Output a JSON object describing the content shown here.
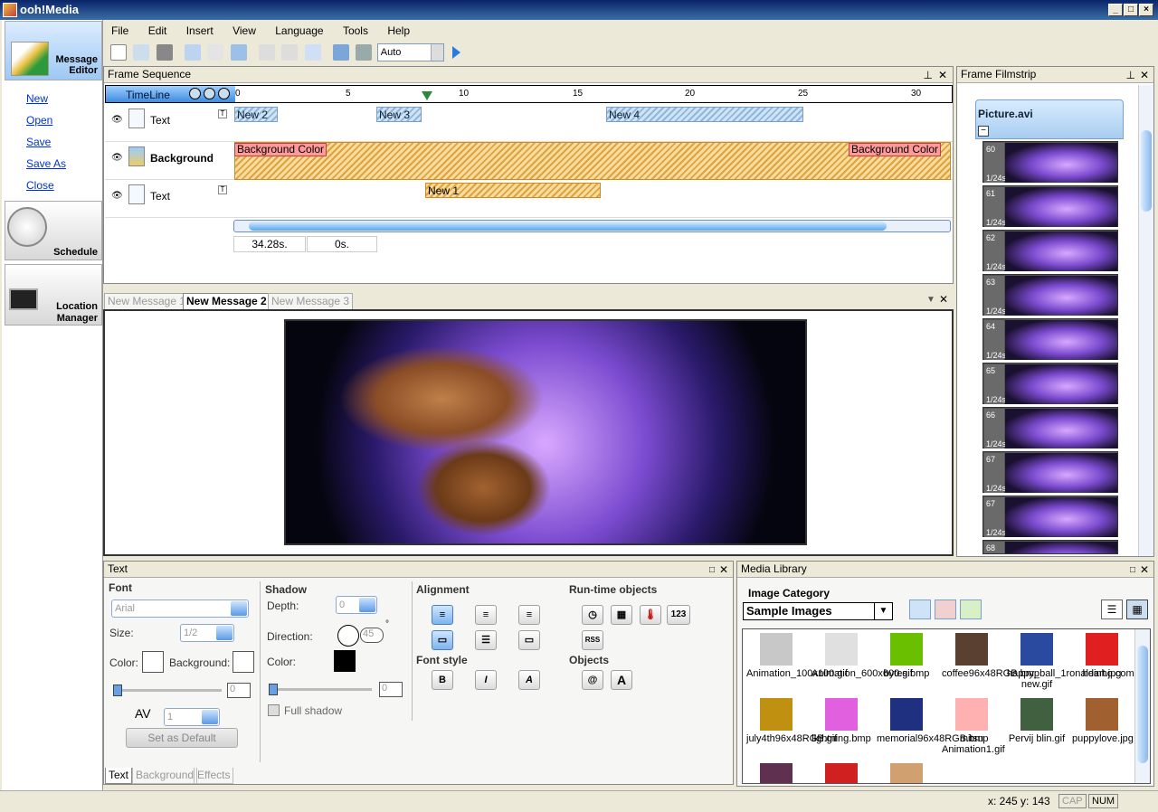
{
  "window": {
    "title": "ooh!Media",
    "min": "_",
    "max": "□",
    "close": "×"
  },
  "menu": [
    "File",
    "Edit",
    "Insert",
    "View",
    "Language",
    "Tools",
    "Help"
  ],
  "toolbar": {
    "zoom_value": "Auto"
  },
  "left_nav": {
    "message_editor": "Message Editor",
    "links": [
      "New",
      "Open",
      "Save",
      "Save As",
      "Close"
    ],
    "schedule": "Schedule",
    "location_manager": "Location Manager"
  },
  "frame_sequence": {
    "title": "Frame Sequence",
    "timeline_label": "TimeLine",
    "ruler_ticks": [
      "0",
      "5",
      "10",
      "15",
      "20",
      "25",
      "30"
    ],
    "tracks": [
      {
        "name": "Text",
        "blocks": [
          "New 2",
          "New 3",
          "New 4"
        ]
      },
      {
        "name": "Background",
        "blocks": [
          "Background Color",
          "Background Color"
        ]
      },
      {
        "name": "Text",
        "blocks": [
          "New 1"
        ]
      }
    ],
    "duration": "34.28s.",
    "position": "0s."
  },
  "editor_tabs": [
    {
      "label": "New Message 1",
      "active": false
    },
    {
      "label": "New Message 2",
      "active": true
    },
    {
      "label": "New Message 3",
      "active": false
    }
  ],
  "filmstrip": {
    "title": "Frame Filmstrip",
    "file": "Picture.avi",
    "frames": [
      {
        "num": "60",
        "dur": "1/24s"
      },
      {
        "num": "61",
        "dur": "1/24s"
      },
      {
        "num": "62",
        "dur": "1/24s"
      },
      {
        "num": "63",
        "dur": "1/24s"
      },
      {
        "num": "64",
        "dur": "1/24s"
      },
      {
        "num": "65",
        "dur": "1/24s"
      },
      {
        "num": "66",
        "dur": "1/24s"
      },
      {
        "num": "67",
        "dur": "1/24s"
      },
      {
        "num": "67",
        "dur": "1/24s"
      },
      {
        "num": "68",
        "dur": ""
      }
    ]
  },
  "text_panel": {
    "title": "Text",
    "font_title": "Font",
    "font_value": "Arial",
    "size_label": "Size:",
    "size_value": "1/2",
    "color_label": "Color:",
    "background_label": "Background:",
    "slider_value": "0",
    "spacing_value": "1",
    "set_default": "Set as Default",
    "shadow_title": "Shadow",
    "depth_label": "Depth:",
    "depth_value": "0",
    "direction_label": "Direction:",
    "direction_value": "45",
    "direction_unit": "°",
    "shadow_color_label": "Color:",
    "shadow_slider_value": "0",
    "full_shadow": "Full shadow",
    "alignment_title": "Alignment",
    "font_style_title": "Font style",
    "runtime_title": "Run-time objects",
    "objects_title": "Objects",
    "runtime_numeric": "123",
    "runtime_rss": "RSS",
    "bold": "B",
    "italic": "I",
    "outline": "A",
    "obj_email": "@",
    "obj_text": "A",
    "tabs": [
      "Text",
      "Background",
      "Effects"
    ]
  },
  "media_library": {
    "title": "Media Library",
    "category_label": "Image Category",
    "category_value": "Sample Images",
    "items": [
      {
        "name": "Animation_100x100.gif",
        "color": "#c8c8c8"
      },
      {
        "name": "Animation_600x600.gif",
        "color": "#e0e0e0"
      },
      {
        "name": "bytes.bmp",
        "color": "#6ac000"
      },
      {
        "name": "coffee96x48RGB.bmp",
        "color": "#5a4030"
      },
      {
        "name": "happy_ball_1ronaldinho.com-new.gif",
        "color": "#2a4aa0"
      },
      {
        "name": "heart.jpg",
        "color": "#e02020"
      },
      {
        "name": "july4th96x48RGB.gif",
        "color": "#c09010"
      },
      {
        "name": "lightning.bmp",
        "color": "#e060e0"
      },
      {
        "name": "memorial96x48RGB.bmp",
        "color": "#203080"
      },
      {
        "name": "mitsu Animation1.gif",
        "color": "#ffb0b0"
      },
      {
        "name": "Pervij blin.gif",
        "color": "#406040"
      },
      {
        "name": "puppylove.jpg",
        "color": "#a06030"
      },
      {
        "name": "",
        "color": "#603050"
      },
      {
        "name": "",
        "color": "#d02020"
      },
      {
        "name": "",
        "color": "#d0a070"
      }
    ]
  },
  "status": {
    "coords": "x: 245  y: 143",
    "cap": "CAP",
    "num": "NUM"
  }
}
